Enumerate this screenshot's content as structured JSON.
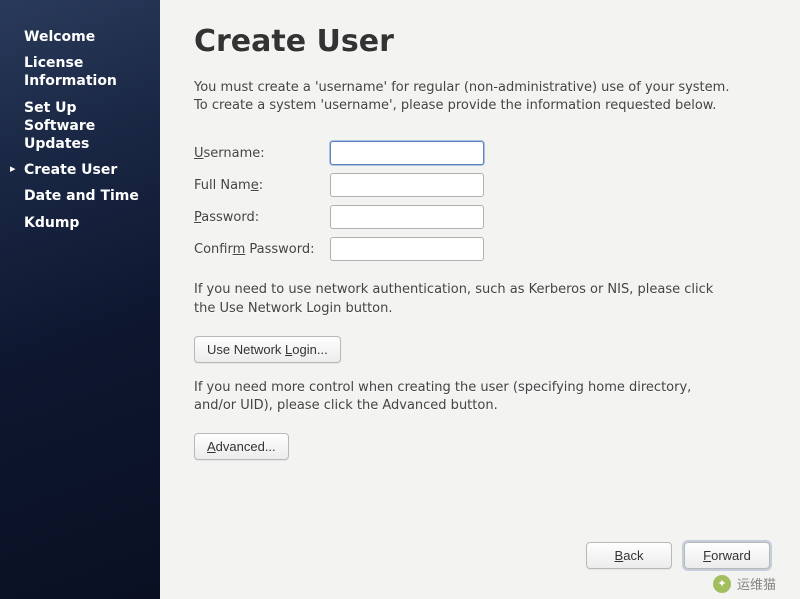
{
  "sidebar": {
    "items": [
      {
        "label": "Welcome",
        "active": false
      },
      {
        "label": "License Information",
        "active": false
      },
      {
        "label": "Set Up Software Updates",
        "active": false
      },
      {
        "label": "Create User",
        "active": true
      },
      {
        "label": "Date and Time",
        "active": false
      },
      {
        "label": "Kdump",
        "active": false
      }
    ]
  },
  "main": {
    "title": "Create User",
    "intro": "You must create a 'username' for regular (non-administrative) use of your system.  To create a system 'username', please provide the information requested below.",
    "form": {
      "username": {
        "label_pre": "U",
        "label_post": "sername:",
        "value": ""
      },
      "fullname": {
        "label_pre": "Full Nam",
        "label_mn": "e",
        "label_post": ":",
        "value": ""
      },
      "password": {
        "label_pre": "P",
        "label_post": "assword:",
        "value": ""
      },
      "confirm": {
        "label_pre": "Confir",
        "label_mn": "m",
        "label_post": " Password:",
        "value": ""
      }
    },
    "net_info": "If you need to use network authentication, such as Kerberos or NIS, please click the Use Network Login button.",
    "net_login_btn": {
      "pre": "Use Network ",
      "mn": "L",
      "post": "ogin..."
    },
    "adv_info": "If you need more control when creating the user (specifying home directory, and/or UID), please click the Advanced button.",
    "advanced_btn": {
      "mn": "A",
      "post": "dvanced..."
    },
    "back_btn": {
      "mn": "B",
      "post": "ack"
    },
    "forward_btn": {
      "mn": "F",
      "post": "orward"
    }
  },
  "watermark": {
    "text": "运维猫"
  }
}
